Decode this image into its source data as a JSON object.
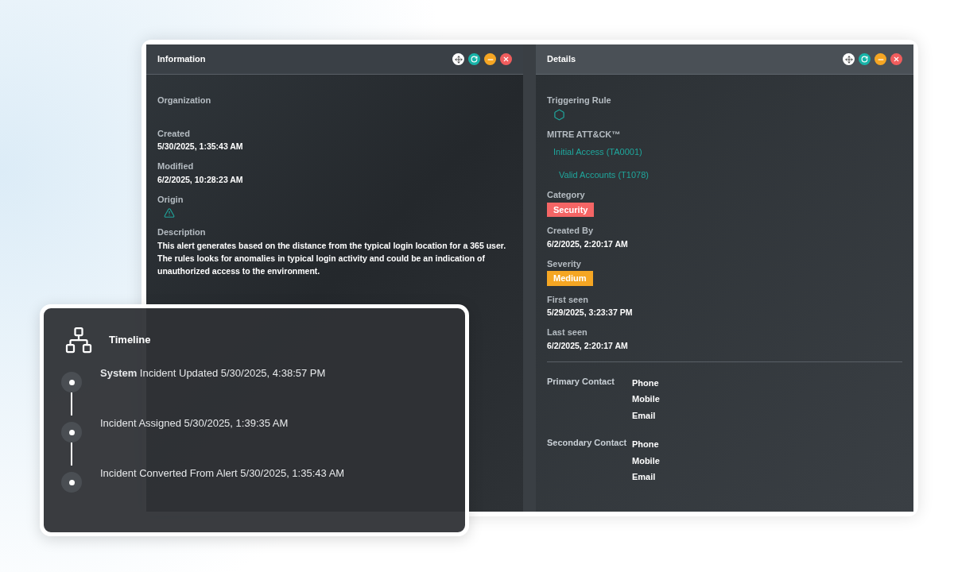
{
  "information": {
    "title": "Information",
    "fields": [
      {
        "label": "Organization",
        "kind": "text"
      },
      {
        "label": "Created",
        "value": "5/30/2025, 1:35:43 AM",
        "kind": "text"
      },
      {
        "label": "Modified",
        "value": "6/2/2025, 10:28:23 AM",
        "kind": "text"
      },
      {
        "label": "Origin",
        "kind": "warning-icon"
      },
      {
        "label": "Description",
        "value": "This alert generates based on the distance from the typical login location for a 365 user. The rules looks for anomalies in typical login activity and could be an indication of unauthorized access to the environment.",
        "kind": "text"
      }
    ]
  },
  "details": {
    "title": "Details",
    "fields": [
      {
        "label": "Triggering Rule",
        "kind": "hexagon-icon"
      },
      {
        "label": "MITRE ATT&CK™",
        "kind": "links",
        "links": [
          "Initial Access (TA0001)",
          "Valid Accounts (T1078)"
        ]
      },
      {
        "label": "Category",
        "kind": "badge",
        "value": "Security",
        "color": "#f56565"
      },
      {
        "label": "Created By",
        "value": "6/2/2025, 2:20:17 AM",
        "kind": "text"
      },
      {
        "label": "Severity",
        "kind": "badge",
        "value": "Medium",
        "color": "#f5a623"
      },
      {
        "label": "First seen",
        "value": "5/29/2025, 3:23:37 PM",
        "kind": "text"
      },
      {
        "label": "Last seen",
        "value": "6/2/2025, 2:20:17 AM",
        "kind": "text"
      }
    ],
    "contacts": [
      {
        "label": "Primary Contact",
        "items": [
          "Phone",
          "Mobile",
          "Email"
        ]
      },
      {
        "label": "Secondary Contact",
        "items": [
          "Phone",
          "Mobile",
          "Email"
        ]
      }
    ]
  },
  "timeline": {
    "title": "Timeline",
    "events": [
      "**System** Incident Updated 5/30/2025, 4:38:57 PM",
      "Incident Assigned 5/30/2025, 1:39:35 AM",
      "Incident Converted From Alert 5/30/2025, 1:35:43 AM"
    ]
  }
}
